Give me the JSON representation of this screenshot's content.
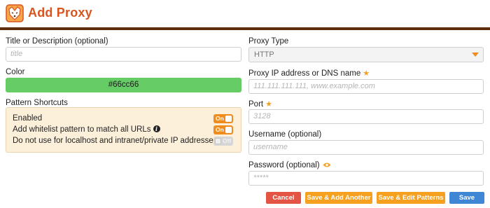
{
  "header": {
    "title": "Add Proxy",
    "logo": "fox-logo-icon",
    "title_color": "#d9541e",
    "bar_color": "#5e2e0c"
  },
  "left": {
    "title_label": "Title or Description (optional)",
    "title_placeholder": "title",
    "color_label": "Color",
    "color_value": "#66cc66",
    "shortcuts_label": "Pattern Shortcuts",
    "shortcuts": [
      {
        "label": "Enabled",
        "state": "On",
        "info": false
      },
      {
        "label": "Add whitelist pattern to match all URLs",
        "state": "On",
        "info": true
      },
      {
        "label": "Do not use for localhost and intranet/private IP addresses",
        "state": "Off",
        "info": true
      }
    ]
  },
  "right": {
    "proxy_type_label": "Proxy Type",
    "proxy_type_value": "HTTP",
    "address_label": "Proxy IP address or DNS name",
    "address_placeholder": "111.111.111.111, www.example.com",
    "port_label": "Port",
    "port_placeholder": "3128",
    "username_label": "Username (optional)",
    "username_placeholder": "username",
    "password_label": "Password (optional)",
    "password_placeholder": "*****"
  },
  "buttons": {
    "cancel": "Cancel",
    "save_add": "Save & Add Another",
    "save_edit": "Save & Edit Patterns",
    "save": "Save"
  },
  "colors": {
    "accent": "#f5a01e",
    "cancel": "#e45445",
    "save": "#3f86d4",
    "shortcuts_bg": "#fdf0db"
  }
}
